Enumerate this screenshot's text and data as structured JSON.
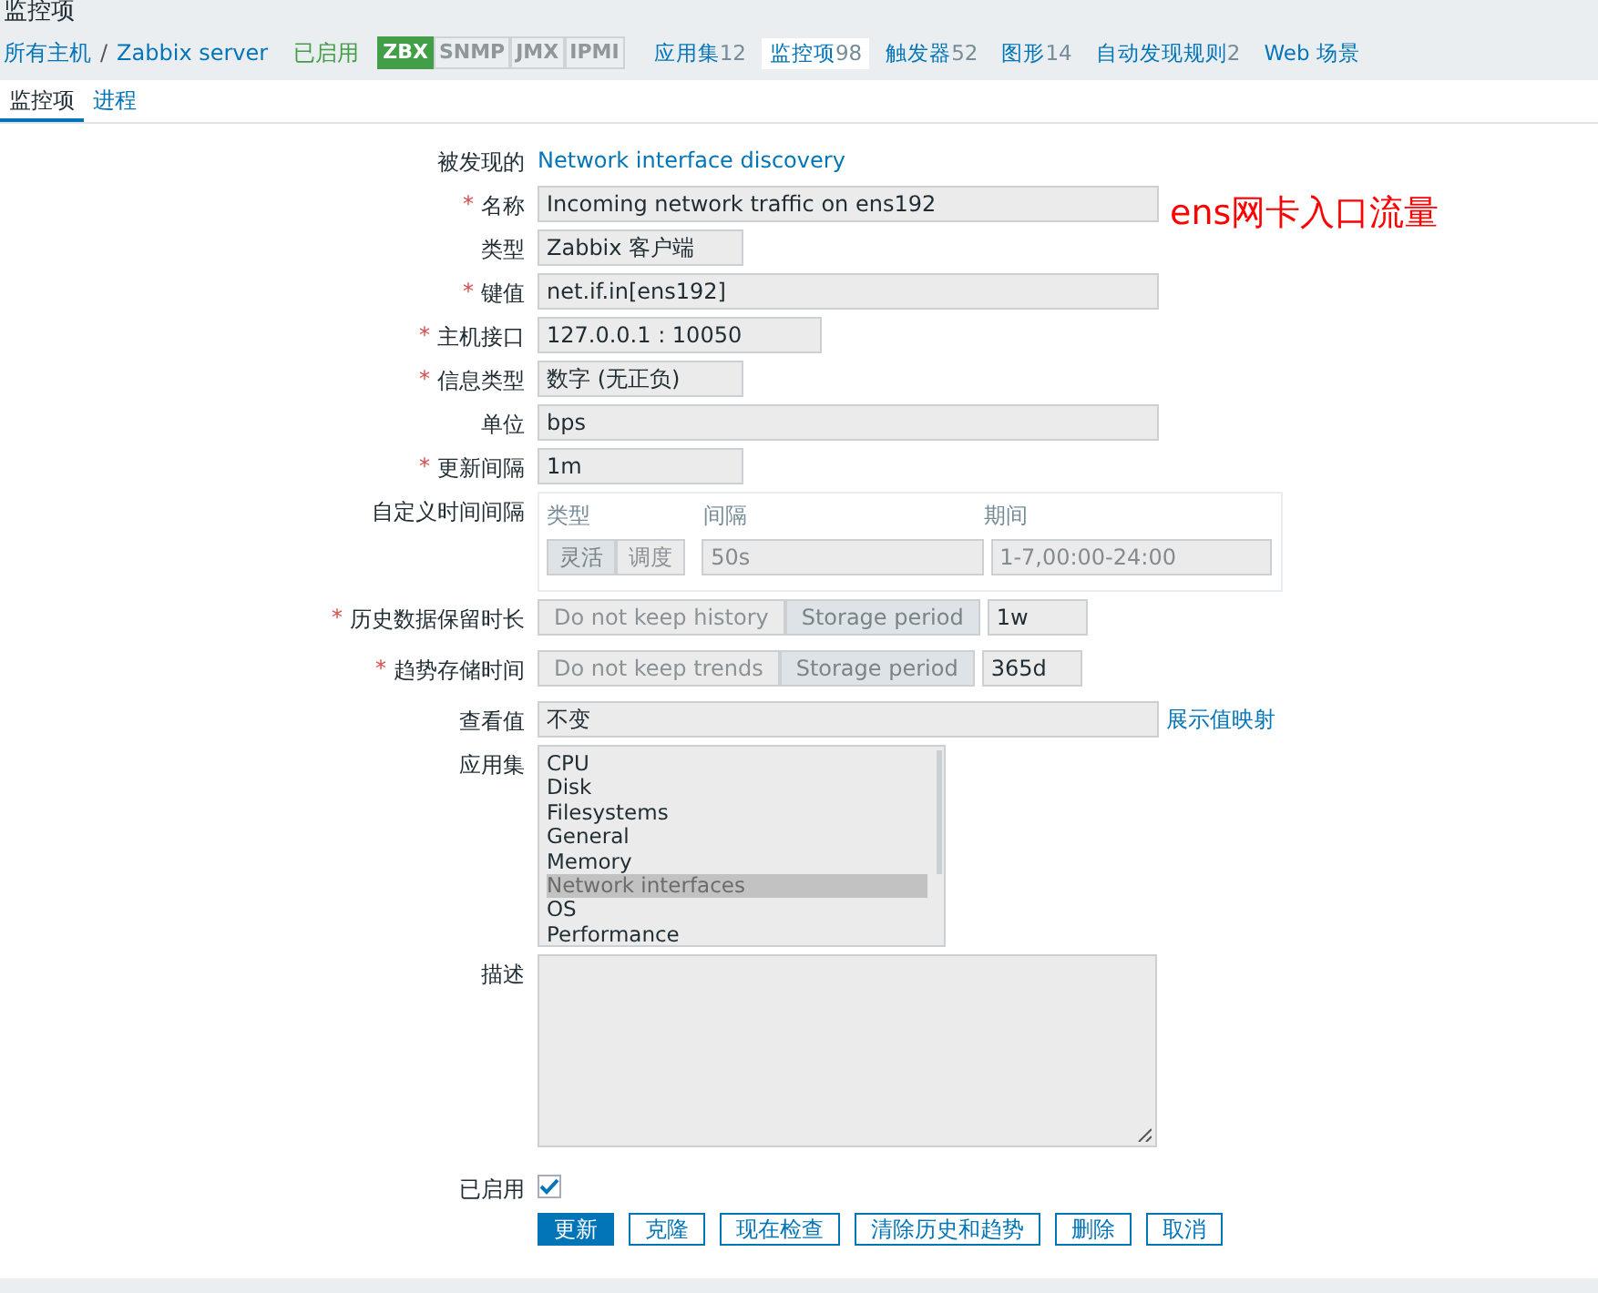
{
  "page_title": "监控项",
  "breadcrumb": {
    "hosts_link": "所有主机",
    "separator": "/",
    "host_link": "Zabbix server",
    "status": "已启用",
    "badges": [
      {
        "label": "ZBX",
        "on": true
      },
      {
        "label": "SNMP",
        "on": false
      },
      {
        "label": "JMX",
        "on": false
      },
      {
        "label": "IPMI",
        "on": false
      }
    ],
    "links": [
      {
        "label": "应用集",
        "count": "12",
        "selected": false
      },
      {
        "label": "监控项",
        "count": "98",
        "selected": true
      },
      {
        "label": "触发器",
        "count": "52",
        "selected": false
      },
      {
        "label": "图形",
        "count": "14",
        "selected": false
      },
      {
        "label": "自动发现规则",
        "count": "2",
        "selected": false
      },
      {
        "label": "Web 场景",
        "selected": false
      }
    ]
  },
  "tabs": [
    {
      "label": "监控项",
      "selected": true
    },
    {
      "label": "进程",
      "selected": false
    }
  ],
  "annotation": "ens网卡入口流量",
  "form": [
    {
      "kind": "link",
      "label": "被发现的",
      "value": "Network interface discovery"
    },
    {
      "kind": "long_input",
      "label": "名称",
      "required_mark": "*",
      "value": "Incoming network traffic on ens192"
    },
    {
      "kind": "short_input",
      "label": "类型",
      "value": "Zabbix 客户端"
    },
    {
      "kind": "long_input",
      "label": "键值",
      "required_mark": "*",
      "value": "net.if.in[ens192]"
    },
    {
      "kind": "medium_input",
      "label": "主机接口",
      "required_mark": "*",
      "value": "127.0.0.1 : 10050"
    },
    {
      "kind": "short_input",
      "label": "信息类型",
      "required_mark": "*",
      "value": "数字 (无正负)"
    },
    {
      "kind": "long_input",
      "label": "单位",
      "value": "bps"
    },
    {
      "kind": "short_input",
      "label": "更新间隔",
      "required_mark": "*",
      "value": "1m"
    },
    {
      "kind": "intervals",
      "label": "自定义时间间隔",
      "headers": [
        "类型",
        "间隔",
        "期间"
      ],
      "modes": [
        {
          "label": "灵活",
          "selected": true
        },
        {
          "label": "调度",
          "selected": false
        }
      ],
      "interval": "50s",
      "period": "1-7,00:00-24:00"
    },
    {
      "kind": "storage",
      "label": "历史数据保留时长",
      "required_mark": "*",
      "options": [
        {
          "label": "Do not keep history",
          "selected": false
        },
        {
          "label": "Storage period",
          "selected": true
        }
      ],
      "value": "1w"
    },
    {
      "kind": "storage",
      "label": "趋势存储时间",
      "required_mark": "*",
      "options": [
        {
          "label": "Do not keep trends",
          "selected": false
        },
        {
          "label": "Storage period",
          "selected": true
        }
      ],
      "value": "365d"
    },
    {
      "kind": "input_link",
      "label": "查看值",
      "value": "不变",
      "link": "展示值映射"
    },
    {
      "kind": "listbox",
      "label": "应用集",
      "items": [
        {
          "label": "CPU",
          "selected": false
        },
        {
          "label": "Disk",
          "selected": false
        },
        {
          "label": "Filesystems",
          "selected": false
        },
        {
          "label": "General",
          "selected": false
        },
        {
          "label": "Memory",
          "selected": false
        },
        {
          "label": "Network interfaces",
          "selected": true
        },
        {
          "label": "OS",
          "selected": false
        },
        {
          "label": "Performance",
          "selected": false
        }
      ]
    },
    {
      "kind": "textarea",
      "label": "描述"
    },
    {
      "kind": "checkbox",
      "label": "已启用",
      "checked": true
    }
  ],
  "buttons": [
    {
      "label": "更新",
      "primary": true
    },
    {
      "label": "克隆",
      "primary": false
    },
    {
      "label": "现在检查",
      "primary": false
    },
    {
      "label": "清除历史和趋势",
      "primary": false
    },
    {
      "label": "删除",
      "primary": false
    },
    {
      "label": "取消",
      "primary": false
    }
  ]
}
